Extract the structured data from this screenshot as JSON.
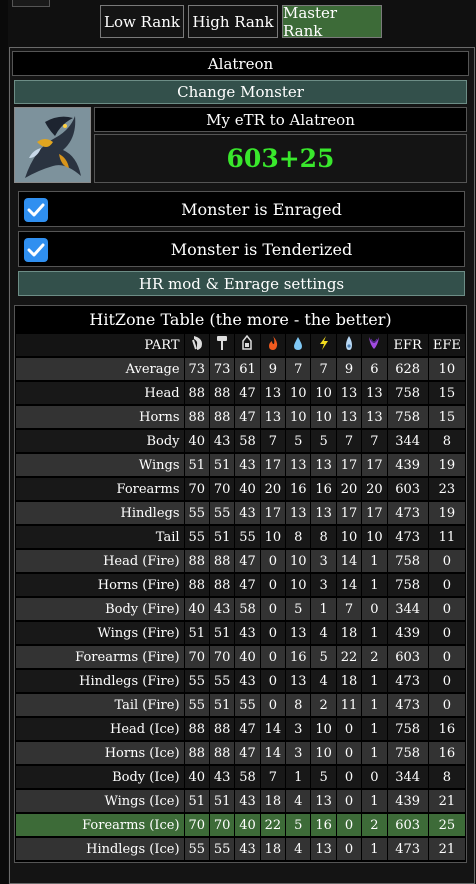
{
  "ranks": [
    {
      "label": "Low Rank",
      "active": false
    },
    {
      "label": "High Rank",
      "active": false
    },
    {
      "label": "Master Rank",
      "active": true
    }
  ],
  "monster": {
    "name": "Alatreon",
    "change_label": "Change Monster",
    "etr_label": "My eTR to Alatreon",
    "etr_value": "603+25"
  },
  "toggles": [
    {
      "label": "Monster is Enraged",
      "checked": true
    },
    {
      "label": "Monster is Tenderized",
      "checked": true
    }
  ],
  "hr_settings_label": "HR mod & Enrage settings",
  "hitzone": {
    "title": "HitZone Table (the more - the better)",
    "part_header": "PART",
    "column_icons": [
      "sever-icon",
      "blunt-icon",
      "ammo-icon",
      "fire-icon",
      "water-icon",
      "thunder-icon",
      "ice-icon",
      "dragon-icon"
    ],
    "efr_header": "EFR",
    "efe_header": "EFE",
    "rows": [
      {
        "part": "Average",
        "values": [
          "73",
          "73",
          "61",
          "9",
          "7",
          "7",
          "9",
          "6"
        ],
        "efr": "628",
        "efe": "10"
      },
      {
        "part": "Head",
        "values": [
          "88",
          "88",
          "47",
          "13",
          "10",
          "10",
          "13",
          "13"
        ],
        "efr": "758",
        "efe": "15"
      },
      {
        "part": "Horns",
        "values": [
          "88",
          "88",
          "47",
          "13",
          "10",
          "10",
          "13",
          "13"
        ],
        "efr": "758",
        "efe": "15"
      },
      {
        "part": "Body",
        "values": [
          "40",
          "43",
          "58",
          "7",
          "5",
          "5",
          "7",
          "7"
        ],
        "efr": "344",
        "efe": "8"
      },
      {
        "part": "Wings",
        "values": [
          "51",
          "51",
          "43",
          "17",
          "13",
          "13",
          "17",
          "17"
        ],
        "efr": "439",
        "efe": "19"
      },
      {
        "part": "Forearms",
        "values": [
          "70",
          "70",
          "40",
          "20",
          "16",
          "16",
          "20",
          "20"
        ],
        "efr": "603",
        "efe": "23"
      },
      {
        "part": "Hindlegs",
        "values": [
          "55",
          "55",
          "43",
          "17",
          "13",
          "13",
          "17",
          "17"
        ],
        "efr": "473",
        "efe": "19"
      },
      {
        "part": "Tail",
        "values": [
          "55",
          "51",
          "55",
          "10",
          "8",
          "8",
          "10",
          "10"
        ],
        "efr": "473",
        "efe": "11"
      },
      {
        "part": "Head (Fire)",
        "values": [
          "88",
          "88",
          "47",
          "0",
          "10",
          "3",
          "14",
          "1"
        ],
        "efr": "758",
        "efe": "0"
      },
      {
        "part": "Horns (Fire)",
        "values": [
          "88",
          "88",
          "47",
          "0",
          "10",
          "3",
          "14",
          "1"
        ],
        "efr": "758",
        "efe": "0"
      },
      {
        "part": "Body (Fire)",
        "values": [
          "40",
          "43",
          "58",
          "0",
          "5",
          "1",
          "7",
          "0"
        ],
        "efr": "344",
        "efe": "0"
      },
      {
        "part": "Wings (Fire)",
        "values": [
          "51",
          "51",
          "43",
          "0",
          "13",
          "4",
          "18",
          "1"
        ],
        "efr": "439",
        "efe": "0"
      },
      {
        "part": "Forearms (Fire)",
        "values": [
          "70",
          "70",
          "40",
          "0",
          "16",
          "5",
          "22",
          "2"
        ],
        "efr": "603",
        "efe": "0"
      },
      {
        "part": "Hindlegs (Fire)",
        "values": [
          "55",
          "55",
          "43",
          "0",
          "13",
          "4",
          "18",
          "1"
        ],
        "efr": "473",
        "efe": "0"
      },
      {
        "part": "Tail (Fire)",
        "values": [
          "55",
          "51",
          "55",
          "0",
          "8",
          "2",
          "11",
          "1"
        ],
        "efr": "473",
        "efe": "0"
      },
      {
        "part": "Head (Ice)",
        "values": [
          "88",
          "88",
          "47",
          "14",
          "3",
          "10",
          "0",
          "1"
        ],
        "efr": "758",
        "efe": "16"
      },
      {
        "part": "Horns (Ice)",
        "values": [
          "88",
          "88",
          "47",
          "14",
          "3",
          "10",
          "0",
          "1"
        ],
        "efr": "758",
        "efe": "16"
      },
      {
        "part": "Body (Ice)",
        "values": [
          "40",
          "43",
          "58",
          "7",
          "1",
          "5",
          "0",
          "0"
        ],
        "efr": "344",
        "efe": "8"
      },
      {
        "part": "Wings (Ice)",
        "values": [
          "51",
          "51",
          "43",
          "18",
          "4",
          "13",
          "0",
          "1"
        ],
        "efr": "439",
        "efe": "21"
      },
      {
        "part": "Forearms (Ice)",
        "values": [
          "70",
          "70",
          "40",
          "22",
          "5",
          "16",
          "0",
          "2"
        ],
        "efr": "603",
        "efe": "25",
        "highlight": true
      },
      {
        "part": "Hindlegs (Ice)",
        "values": [
          "55",
          "55",
          "43",
          "18",
          "4",
          "13",
          "0",
          "1"
        ],
        "efr": "473",
        "efe": "21"
      }
    ]
  }
}
